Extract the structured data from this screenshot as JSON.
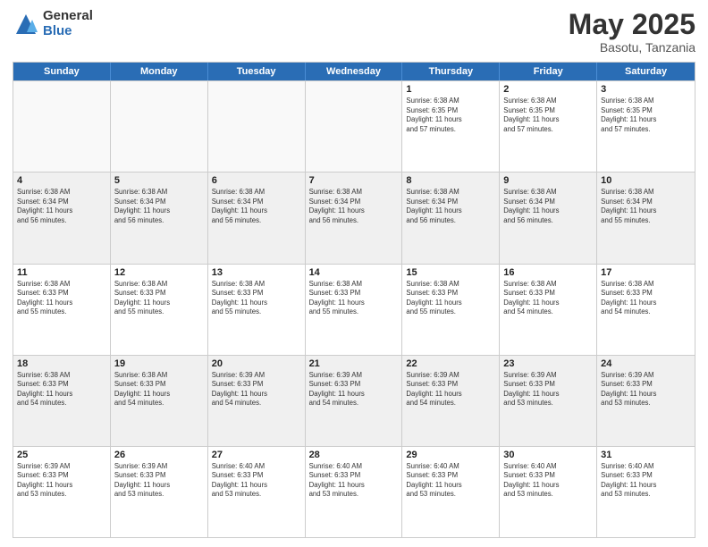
{
  "logo": {
    "general": "General",
    "blue": "Blue"
  },
  "title": "May 2025",
  "subtitle": "Basotu, Tanzania",
  "days": [
    "Sunday",
    "Monday",
    "Tuesday",
    "Wednesday",
    "Thursday",
    "Friday",
    "Saturday"
  ],
  "weeks": [
    [
      {
        "num": "",
        "text": "",
        "empty": true
      },
      {
        "num": "",
        "text": "",
        "empty": true
      },
      {
        "num": "",
        "text": "",
        "empty": true
      },
      {
        "num": "",
        "text": "",
        "empty": true
      },
      {
        "num": "1",
        "text": "Sunrise: 6:38 AM\nSunset: 6:35 PM\nDaylight: 11 hours\nand 57 minutes."
      },
      {
        "num": "2",
        "text": "Sunrise: 6:38 AM\nSunset: 6:35 PM\nDaylight: 11 hours\nand 57 minutes."
      },
      {
        "num": "3",
        "text": "Sunrise: 6:38 AM\nSunset: 6:35 PM\nDaylight: 11 hours\nand 57 minutes."
      }
    ],
    [
      {
        "num": "4",
        "text": "Sunrise: 6:38 AM\nSunset: 6:34 PM\nDaylight: 11 hours\nand 56 minutes."
      },
      {
        "num": "5",
        "text": "Sunrise: 6:38 AM\nSunset: 6:34 PM\nDaylight: 11 hours\nand 56 minutes."
      },
      {
        "num": "6",
        "text": "Sunrise: 6:38 AM\nSunset: 6:34 PM\nDaylight: 11 hours\nand 56 minutes."
      },
      {
        "num": "7",
        "text": "Sunrise: 6:38 AM\nSunset: 6:34 PM\nDaylight: 11 hours\nand 56 minutes."
      },
      {
        "num": "8",
        "text": "Sunrise: 6:38 AM\nSunset: 6:34 PM\nDaylight: 11 hours\nand 56 minutes."
      },
      {
        "num": "9",
        "text": "Sunrise: 6:38 AM\nSunset: 6:34 PM\nDaylight: 11 hours\nand 56 minutes."
      },
      {
        "num": "10",
        "text": "Sunrise: 6:38 AM\nSunset: 6:34 PM\nDaylight: 11 hours\nand 55 minutes."
      }
    ],
    [
      {
        "num": "11",
        "text": "Sunrise: 6:38 AM\nSunset: 6:33 PM\nDaylight: 11 hours\nand 55 minutes."
      },
      {
        "num": "12",
        "text": "Sunrise: 6:38 AM\nSunset: 6:33 PM\nDaylight: 11 hours\nand 55 minutes."
      },
      {
        "num": "13",
        "text": "Sunrise: 6:38 AM\nSunset: 6:33 PM\nDaylight: 11 hours\nand 55 minutes."
      },
      {
        "num": "14",
        "text": "Sunrise: 6:38 AM\nSunset: 6:33 PM\nDaylight: 11 hours\nand 55 minutes."
      },
      {
        "num": "15",
        "text": "Sunrise: 6:38 AM\nSunset: 6:33 PM\nDaylight: 11 hours\nand 55 minutes."
      },
      {
        "num": "16",
        "text": "Sunrise: 6:38 AM\nSunset: 6:33 PM\nDaylight: 11 hours\nand 54 minutes."
      },
      {
        "num": "17",
        "text": "Sunrise: 6:38 AM\nSunset: 6:33 PM\nDaylight: 11 hours\nand 54 minutes."
      }
    ],
    [
      {
        "num": "18",
        "text": "Sunrise: 6:38 AM\nSunset: 6:33 PM\nDaylight: 11 hours\nand 54 minutes."
      },
      {
        "num": "19",
        "text": "Sunrise: 6:38 AM\nSunset: 6:33 PM\nDaylight: 11 hours\nand 54 minutes."
      },
      {
        "num": "20",
        "text": "Sunrise: 6:39 AM\nSunset: 6:33 PM\nDaylight: 11 hours\nand 54 minutes."
      },
      {
        "num": "21",
        "text": "Sunrise: 6:39 AM\nSunset: 6:33 PM\nDaylight: 11 hours\nand 54 minutes."
      },
      {
        "num": "22",
        "text": "Sunrise: 6:39 AM\nSunset: 6:33 PM\nDaylight: 11 hours\nand 54 minutes."
      },
      {
        "num": "23",
        "text": "Sunrise: 6:39 AM\nSunset: 6:33 PM\nDaylight: 11 hours\nand 53 minutes."
      },
      {
        "num": "24",
        "text": "Sunrise: 6:39 AM\nSunset: 6:33 PM\nDaylight: 11 hours\nand 53 minutes."
      }
    ],
    [
      {
        "num": "25",
        "text": "Sunrise: 6:39 AM\nSunset: 6:33 PM\nDaylight: 11 hours\nand 53 minutes."
      },
      {
        "num": "26",
        "text": "Sunrise: 6:39 AM\nSunset: 6:33 PM\nDaylight: 11 hours\nand 53 minutes."
      },
      {
        "num": "27",
        "text": "Sunrise: 6:40 AM\nSunset: 6:33 PM\nDaylight: 11 hours\nand 53 minutes."
      },
      {
        "num": "28",
        "text": "Sunrise: 6:40 AM\nSunset: 6:33 PM\nDaylight: 11 hours\nand 53 minutes."
      },
      {
        "num": "29",
        "text": "Sunrise: 6:40 AM\nSunset: 6:33 PM\nDaylight: 11 hours\nand 53 minutes."
      },
      {
        "num": "30",
        "text": "Sunrise: 6:40 AM\nSunset: 6:33 PM\nDaylight: 11 hours\nand 53 minutes."
      },
      {
        "num": "31",
        "text": "Sunrise: 6:40 AM\nSunset: 6:33 PM\nDaylight: 11 hours\nand 53 minutes."
      }
    ]
  ]
}
